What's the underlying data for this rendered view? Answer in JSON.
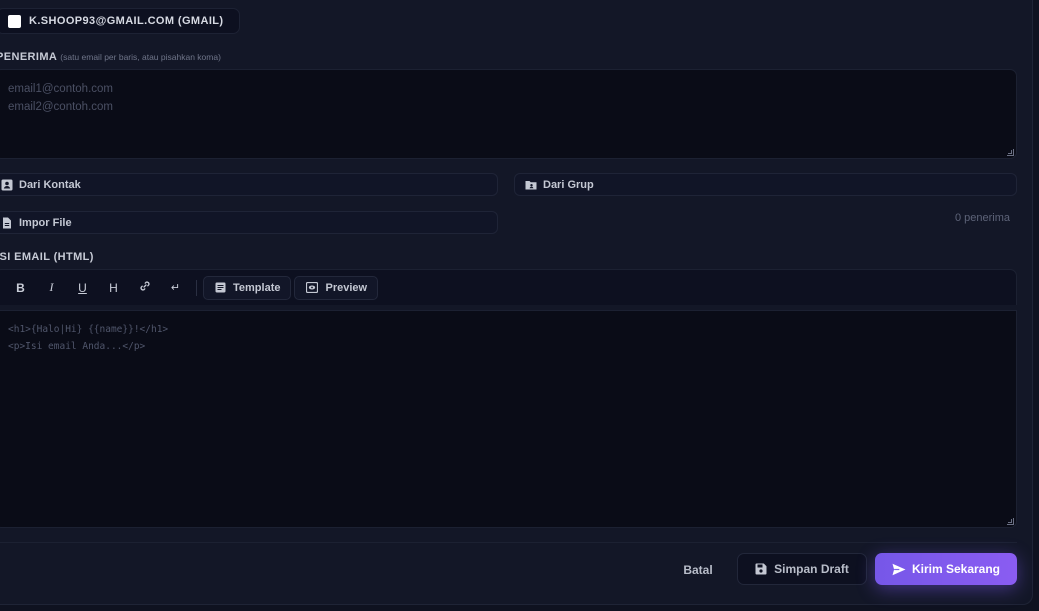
{
  "sender": {
    "label": "K.SHOOP93@GMAIL.COM (GMAIL)",
    "checked": false
  },
  "recipients": {
    "label": "PENERIMA",
    "hint": "(satu email per baris, atau pisahkan koma)",
    "placeholder_lines": [
      "email1@contoh.com",
      "email2@contoh.com"
    ]
  },
  "sources": {
    "from_contacts": "Dari Kontak",
    "from_group": "Dari Grup",
    "import_file": "Impor File"
  },
  "recipient_count": "0 penerima",
  "body": {
    "label": "ISI EMAIL (HTML)",
    "toolbar": {
      "bold": "B",
      "italic": "I",
      "underline": "U",
      "heading": "H",
      "link_icon": "link-icon",
      "linebreak": "↵",
      "template": "Template",
      "preview": "Preview"
    },
    "placeholder_lines": [
      "<h1>{Halo|Hi} {{name}}!</h1>",
      "<p>Isi email Anda...</p>"
    ]
  },
  "actions": {
    "cancel": "Batal",
    "save_draft": "Simpan Draft",
    "send_now": "Kirim Sekarang"
  },
  "colors": {
    "accent": "#7c5cf0",
    "background": "#131727",
    "input_bg": "#0a0c17"
  }
}
